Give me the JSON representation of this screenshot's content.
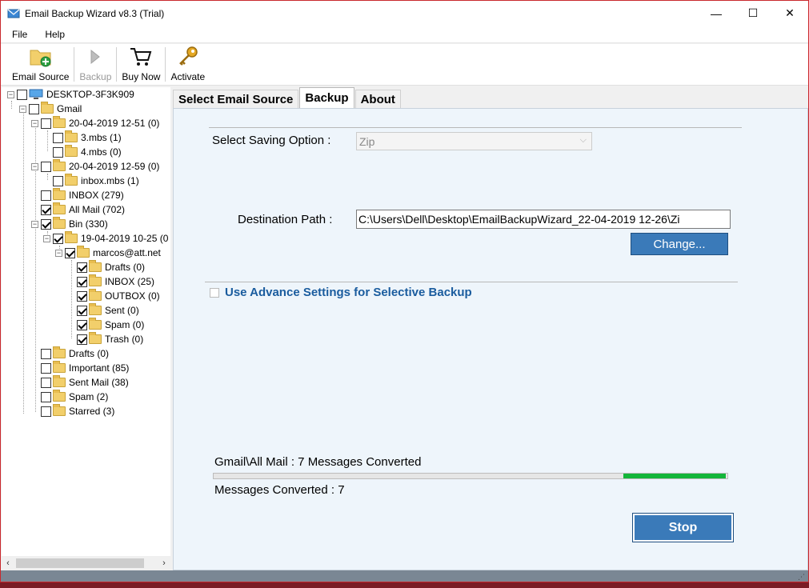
{
  "window": {
    "title": "Email Backup Wizard v8.3 (Trial)",
    "minimize": "—",
    "maximize": "☐",
    "close": "✕"
  },
  "menu": [
    {
      "label": "File"
    },
    {
      "label": "Help"
    }
  ],
  "toolbar": {
    "email_source": "Email Source",
    "backup": "Backup",
    "buy_now": "Buy Now",
    "activate": "Activate"
  },
  "tree": {
    "root": "DESKTOP-3F3K909",
    "gmail": "Gmail",
    "items": [
      {
        "label": "20-04-2019 12-51 (0)"
      },
      {
        "label": "3.mbs (1)"
      },
      {
        "label": "4.mbs (0)"
      },
      {
        "label": "20-04-2019 12-59 (0)"
      },
      {
        "label": "inbox.mbs (1)"
      },
      {
        "label": "INBOX (279)"
      },
      {
        "label": "All Mail (702)"
      },
      {
        "label": "Bin (330)"
      },
      {
        "label": "19-04-2019 10-25 (0"
      },
      {
        "label": "marcos@att.net"
      },
      {
        "label": "Drafts (0)"
      },
      {
        "label": "INBOX (25)"
      },
      {
        "label": "OUTBOX (0)"
      },
      {
        "label": "Sent (0)"
      },
      {
        "label": "Spam (0)"
      },
      {
        "label": "Trash (0)"
      },
      {
        "label": "Drafts (0)"
      },
      {
        "label": "Important (85)"
      },
      {
        "label": "Sent Mail (38)"
      },
      {
        "label": "Spam (2)"
      },
      {
        "label": "Starred (3)"
      }
    ]
  },
  "tabs": [
    {
      "label": "Select Email Source"
    },
    {
      "label": "Backup"
    },
    {
      "label": "About"
    }
  ],
  "backup": {
    "saving_option_label": "Select Saving Option :",
    "saving_option_value": "Zip",
    "destination_label": "Destination Path :",
    "destination_value": "C:\\Users\\Dell\\Desktop\\EmailBackupWizard_22-04-2019 12-26\\Zi",
    "change_button": "Change...",
    "advance_settings": "Use Advance Settings for Selective Backup",
    "status_line": "Gmail\\All Mail : 7 Messages Converted",
    "messages_converted": "Messages Converted : 7",
    "progress_fraction": 0.2,
    "stop_button": "Stop"
  },
  "colors": {
    "accent": "#3a7ab9",
    "progress": "#13b53a",
    "link": "#1a5c9e"
  }
}
